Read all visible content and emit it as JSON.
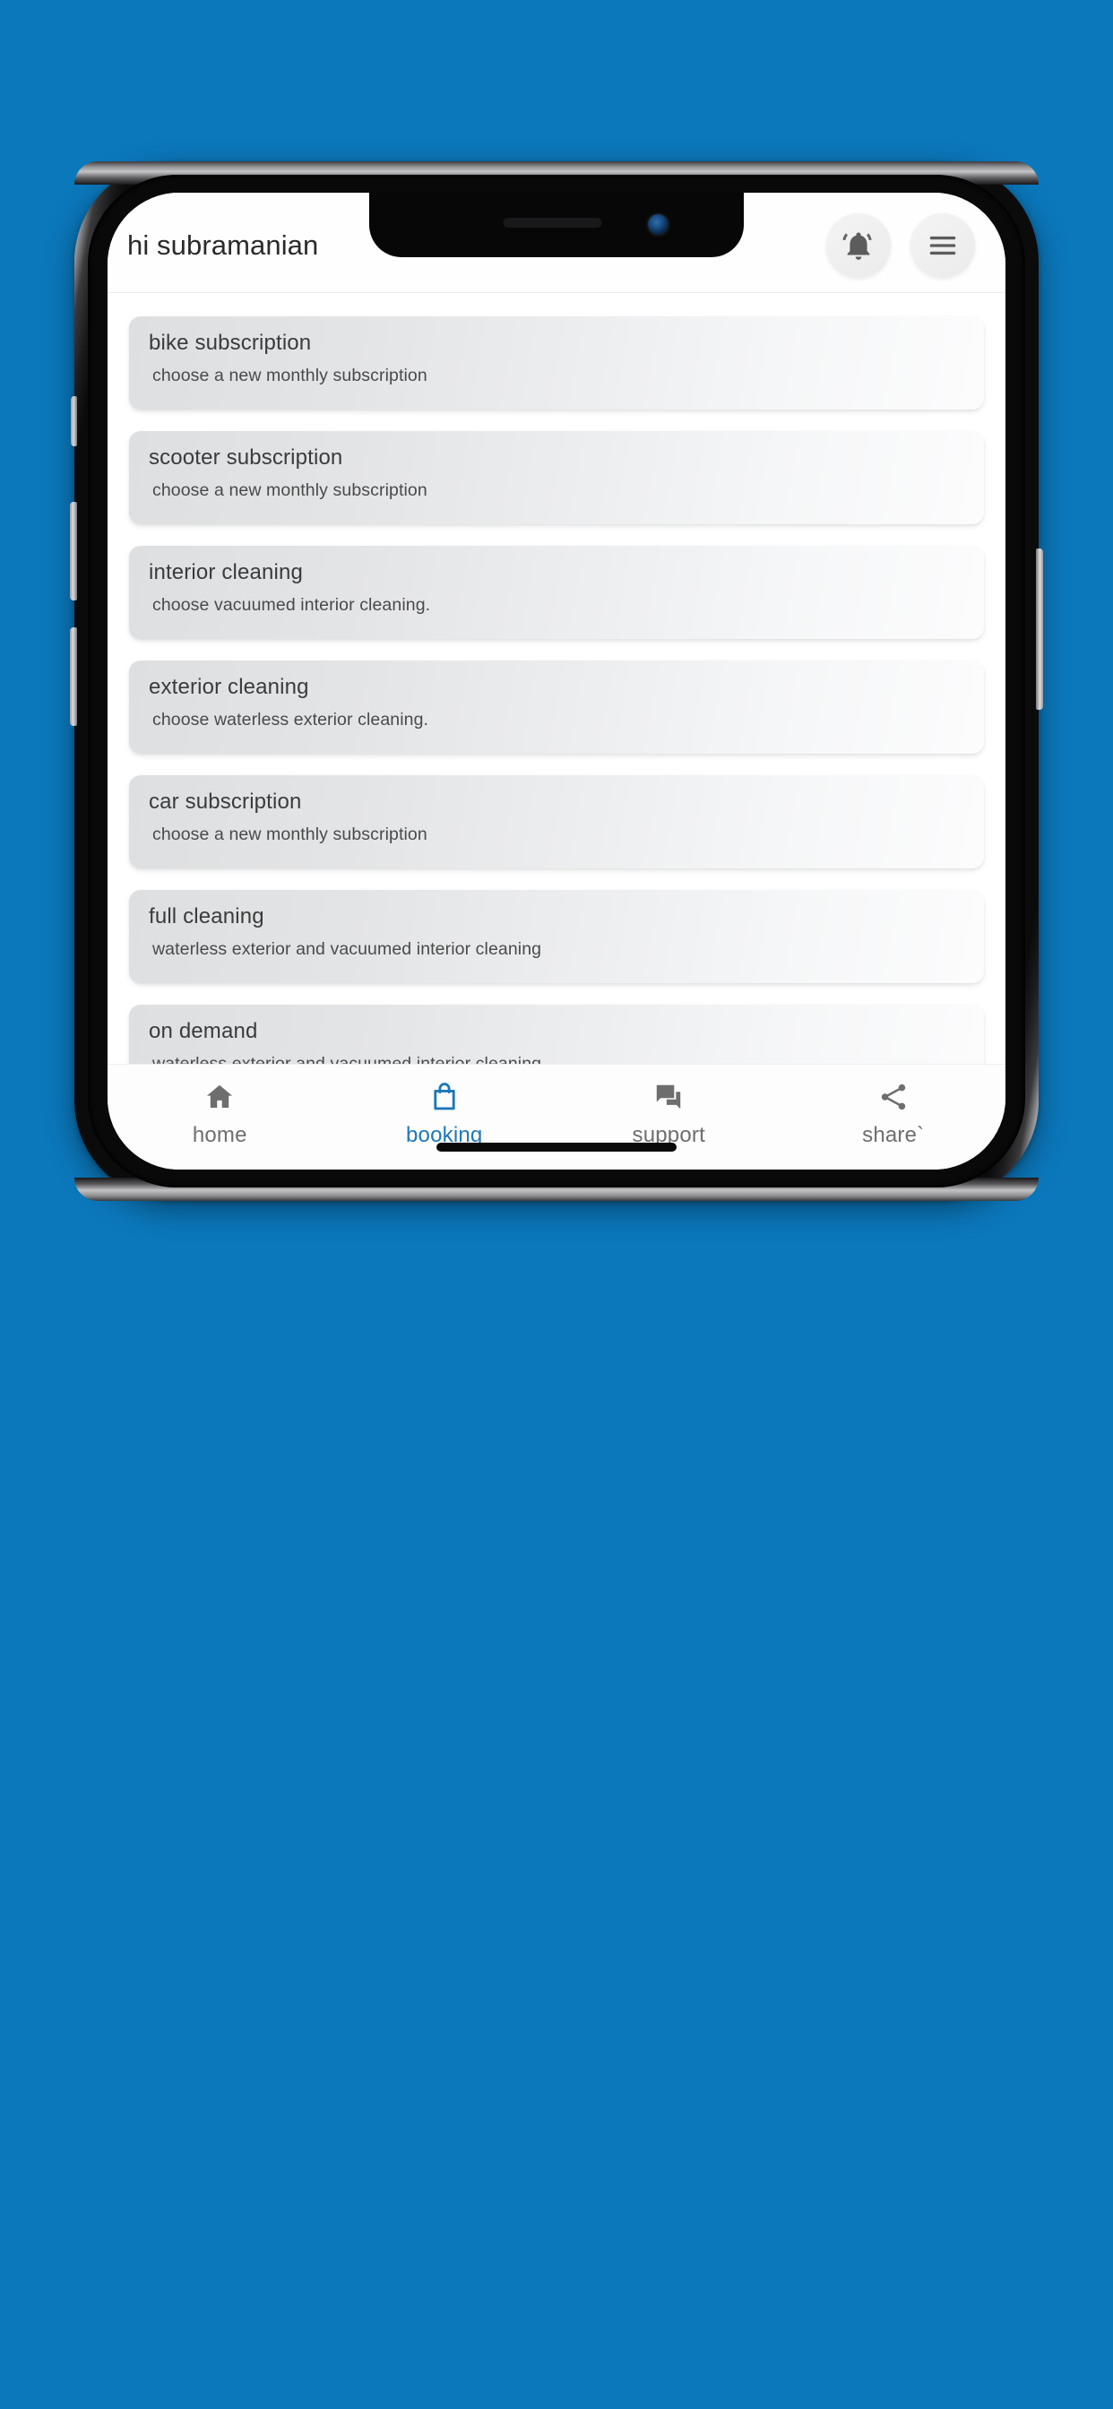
{
  "theme": {
    "background_color": "#0b78bc",
    "accent_color": "#1d78b8",
    "inactive_color": "#6e6e6e",
    "card_gradient_start": "#dddfe1",
    "card_gradient_end": "#fcfcfd"
  },
  "header": {
    "greeting": "hi subramanian",
    "notifications_icon": "bell-icon",
    "menu_icon": "hamburger-menu-icon"
  },
  "services": [
    {
      "title": "bike subscription",
      "subtitle": "choose a new monthly subscription"
    },
    {
      "title": "scooter subscription",
      "subtitle": "choose a new monthly subscription"
    },
    {
      "title": "interior cleaning",
      "subtitle": "choose vacuumed interior cleaning."
    },
    {
      "title": "exterior cleaning",
      "subtitle": "choose waterless exterior cleaning."
    },
    {
      "title": "car subscription",
      "subtitle": "choose a new monthly subscription"
    },
    {
      "title": "full cleaning",
      "subtitle": "waterless exterior and vacuumed interior cleaning"
    },
    {
      "title": "on demand",
      "subtitle": "waterless exterior and vacuumed interior cleaning"
    }
  ],
  "bottom_nav": {
    "items": [
      {
        "label": "home",
        "icon": "home-icon",
        "active": false
      },
      {
        "label": "booking",
        "icon": "shopping-bag-icon",
        "active": true
      },
      {
        "label": "support",
        "icon": "chat-bubble-icon",
        "active": false
      },
      {
        "label": "share`",
        "icon": "share-nodes-icon",
        "active": false
      }
    ]
  }
}
